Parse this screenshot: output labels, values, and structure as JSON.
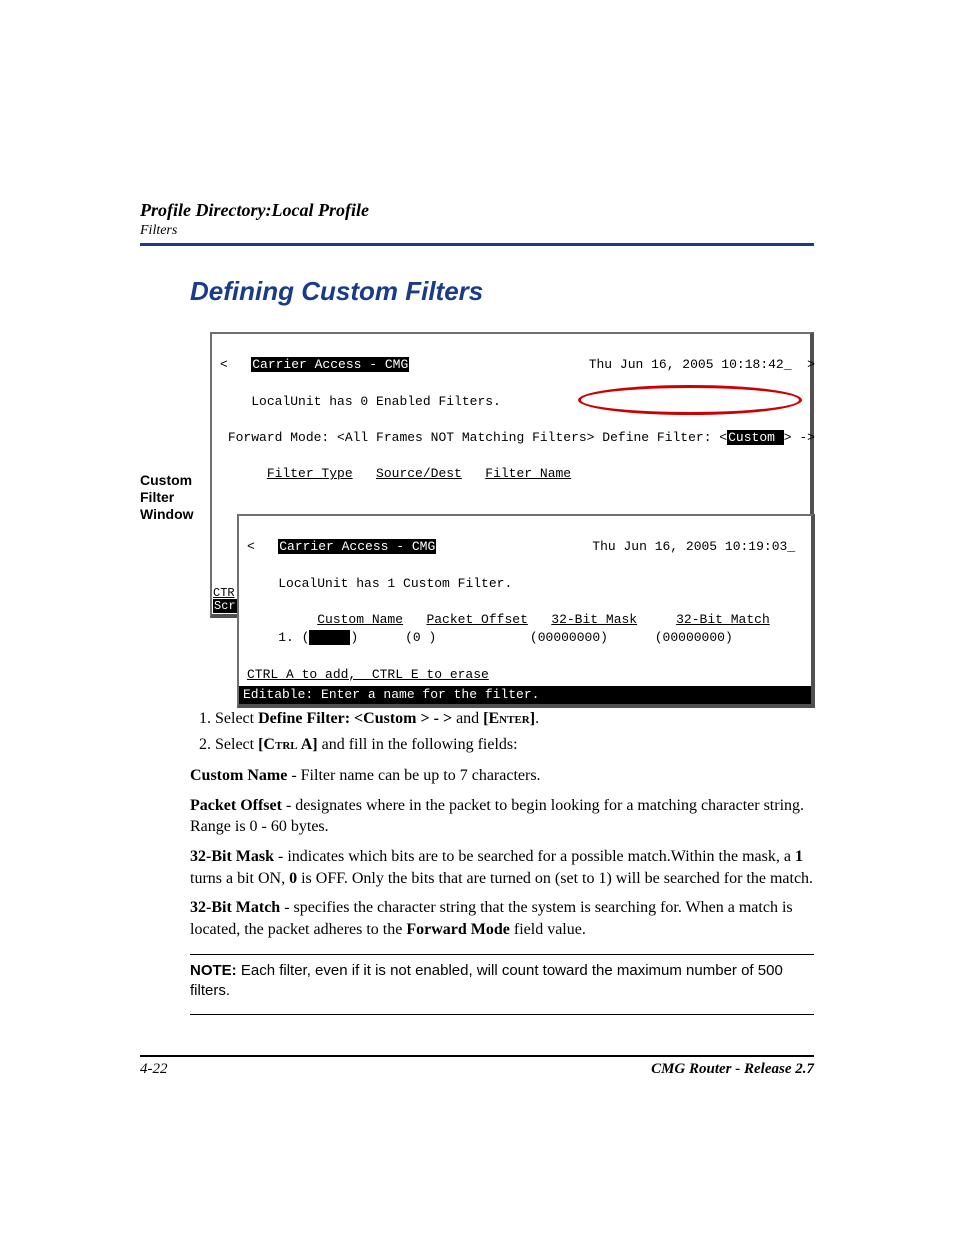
{
  "header": {
    "title": "Profile Directory:Local Profile",
    "sub": "Filters"
  },
  "section_title": "Defining Custom Filters",
  "callout": {
    "l1": "Custom",
    "l2": "Filter",
    "l3": "Window"
  },
  "term1": {
    "app": "Carrier Access - CMG",
    "ts": "Thu Jun 16, 2005 10:18:42_",
    "status": "LocalUnit has 0 Enabled Filters.",
    "fwd_label": "Forward Mode: ",
    "fwd_val": "<All Frames NOT Matching Filters>",
    "def_label": " Define Filter: <",
    "def_val": "Custom ",
    "def_tail": "> ->",
    "col1": "Filter Type",
    "col2": "Source/Dest",
    "col3": "Filter Name",
    "trunc1": "CTR",
    "trunc2": "Scr"
  },
  "term2": {
    "app": "Carrier Access - CMG",
    "ts": "Thu Jun 16, 2005 10:19:03_",
    "status": "LocalUnit has 1 Custom Filter.",
    "col1": "Custom Name",
    "col2": "Packet Offset",
    "col3": "32-Bit Mask",
    "col4": "32-Bit Match",
    "row_idx": "1. (",
    "row_name": "     ",
    "row_name_tail": ")",
    "row_off": "(0 )",
    "row_mask": "(00000000)",
    "row_match": "(00000000)",
    "help": "CTRL A to add,  CTRL E to erase",
    "status2": "Editable: Enter a name for the filter.                                       "
  },
  "steps": {
    "s1a": "Select ",
    "s1b": "Define Filter: <Custom > - >",
    "s1c": " and ",
    "s1d": "[Enter]",
    "s1e": ".",
    "s2a": "Select ",
    "s2b": "[Ctrl A]",
    "s2c": " and fill in the following fields:"
  },
  "defs": {
    "cn_t": "Custom Name",
    "cn_b": " - Filter name can be up to 7 characters.",
    "po_t": "Packet Offset",
    "po_b": " - designates where in the packet to begin looking for a matching character string. Range is 0 - 60 bytes.",
    "mk_t": "32-Bit Mask",
    "mk_b1": " - indicates which bits are to be searched for a possible match.Within the mask, a ",
    "mk_b2": "1",
    "mk_b3": " turns a bit ON, ",
    "mk_b4": "0",
    "mk_b5": " is OFF. Only the bits that are turned on (set to 1) will be searched for the match.",
    "mt_t": "32-Bit Match",
    "mt_b1": " - specifies the character string that the system is searching for. When a match is located, the packet adheres to the ",
    "mt_b2": "Forward Mode",
    "mt_b3": " field value."
  },
  "note": {
    "label": "NOTE:  ",
    "body": "Each filter, even if it is not enabled, will count toward the maximum number of 500 filters."
  },
  "footer": {
    "page": "4-22",
    "doc": "CMG Router - Release 2.7"
  }
}
